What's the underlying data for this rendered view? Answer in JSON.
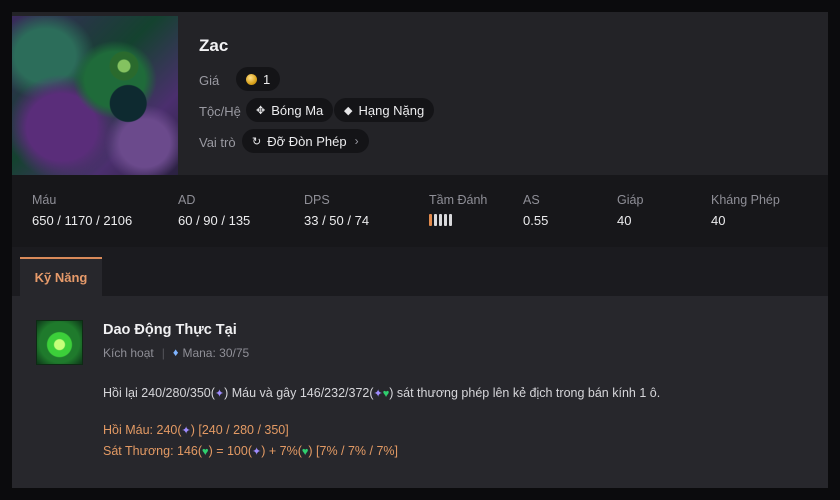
{
  "champion": {
    "name": "Zac",
    "cost_label": "Giá",
    "cost_value": "1",
    "traits_label": "Tộc/Hệ",
    "traits": [
      "Bóng Ma",
      "Hạng Nặng"
    ],
    "role_label": "Vai trò",
    "role": "Đỡ Đòn Phép"
  },
  "stats": [
    {
      "label": "Máu",
      "value": "650 / 1170 / 2106"
    },
    {
      "label": "AD",
      "value": "60 / 90 / 135"
    },
    {
      "label": "DPS",
      "value": "33 / 50 / 74"
    },
    {
      "label": "Tầm Đánh",
      "range_level": 1,
      "range_max": 5
    },
    {
      "label": "AS",
      "value": "0.55"
    },
    {
      "label": "Giáp",
      "value": "40"
    },
    {
      "label": "Kháng Phép",
      "value": "40"
    }
  ],
  "tabs": [
    {
      "label": "Kỹ Năng",
      "active": true
    }
  ],
  "skill": {
    "name": "Dao Động Thực Tại",
    "type": "Kích hoạt",
    "mana": "Mana: 30/75",
    "desc_1": "Hồi lại 240/280/350(",
    "desc_2": ") Máu và gây 146/232/372(",
    "desc_3": ") sát thương phép lên kẻ địch trong bán kính 1 ô.",
    "heal_1": "Hồi Máu: 240(",
    "heal_2": ") [240 / 280 / 350]",
    "dmg_1": "Sát Thương: 146(",
    "dmg_2": ") = 100(",
    "dmg_3": ") + 7%(",
    "dmg_4": ") [7% / 7% / 7%]"
  },
  "icons": {
    "coin": "gold-coin-icon",
    "trait_ghost": "ghost-trait-icon",
    "trait_heavy": "heavy-trait-icon",
    "role": "tank-role-icon",
    "mana": "mana-drop-icon",
    "ap": "ability-power-icon",
    "health": "health-heart-icon"
  },
  "colors": {
    "accent": "#e69a6a",
    "ap": "#9f8cff",
    "health": "#2fcf6e"
  }
}
